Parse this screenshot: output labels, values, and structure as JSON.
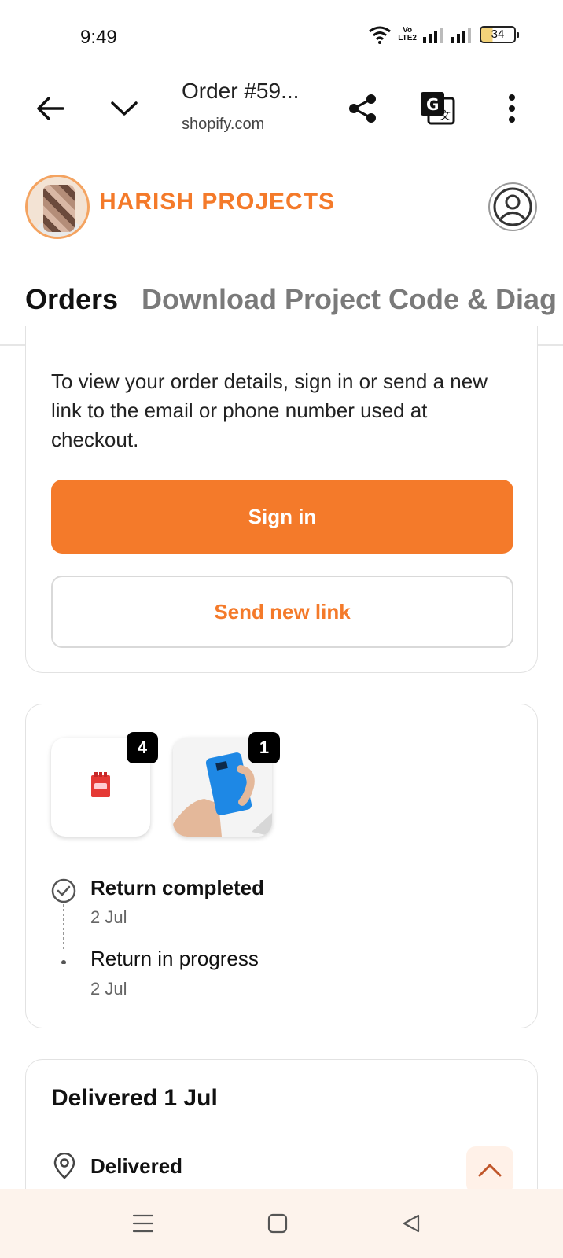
{
  "status_bar": {
    "time": "9:49",
    "battery": "34",
    "volte_line1": "Vo",
    "volte_line2": "LTE2"
  },
  "browser": {
    "title": "Order #59...",
    "url": "shopify.com"
  },
  "store": {
    "brand": "HARISH PROJECTS"
  },
  "tabs": [
    {
      "label": "Orders",
      "active": true
    },
    {
      "label": "Download Project Code & Diag",
      "active": false
    }
  ],
  "signin_card": {
    "message": "To view your order details, sign in or send a new link to the email or phone number used at checkout.",
    "sign_in_label": "Sign in",
    "send_link_label": "Send new link"
  },
  "order_card": {
    "items": [
      {
        "quantity": "4",
        "image": "red-module-product"
      },
      {
        "quantity": "1",
        "image": "blue-device-in-hand"
      }
    ],
    "timeline": [
      {
        "status": "Return completed",
        "date": "2 Jul",
        "icon": "check-circle-icon"
      },
      {
        "status": "Return in progress",
        "date": "2 Jul",
        "icon": "dot-icon"
      }
    ]
  },
  "delivery_card": {
    "title": "Delivered 1 Jul",
    "status": "Delivered",
    "icon": "location-pin-icon"
  },
  "colors": {
    "accent": "#f47a2a"
  }
}
